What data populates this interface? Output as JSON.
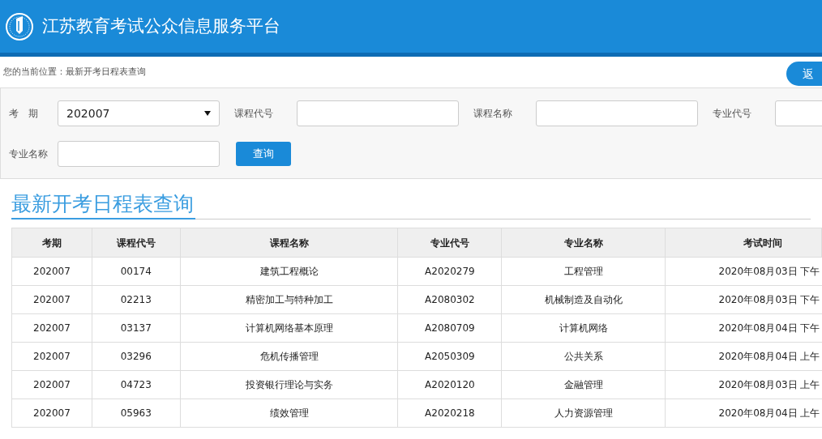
{
  "header": {
    "title": "江苏教育考试公众信息服务平台"
  },
  "breadcrumb": "您的当前位置：最新开考日程表查询",
  "back_button": "返",
  "filters": [
    {
      "kind": "select",
      "label": "考　期",
      "value": "202007"
    },
    {
      "kind": "input",
      "label": "课程代号"
    },
    {
      "kind": "input",
      "label": "课程名称"
    },
    {
      "kind": "input",
      "label": "专业代号"
    },
    {
      "kind": "input",
      "label": "专业名称"
    }
  ],
  "search_button": "查询",
  "section_title": "最新开考日程表查询",
  "table": {
    "columns": [
      "考期",
      "课程代号",
      "课程名称",
      "专业代号",
      "专业名称",
      "考试时间"
    ],
    "rows": [
      [
        "202007",
        "00174",
        "建筑工程概论",
        "A2020279",
        "工程管理",
        "2020年08月03日 下午"
      ],
      [
        "202007",
        "02213",
        "精密加工与特种加工",
        "A2080302",
        "机械制造及自动化",
        "2020年08月03日 下午"
      ],
      [
        "202007",
        "03137",
        "计算机网络基本原理",
        "A2080709",
        "计算机网络",
        "2020年08月04日 下午"
      ],
      [
        "202007",
        "03296",
        "危机传播管理",
        "A2050309",
        "公共关系",
        "2020年08月04日 上午"
      ],
      [
        "202007",
        "04723",
        "投资银行理论与实务",
        "A2020120",
        "金融管理",
        "2020年08月03日 上午"
      ],
      [
        "202007",
        "05963",
        "绩效管理",
        "A2020218",
        "人力资源管理",
        "2020年08月04日 上午"
      ]
    ]
  }
}
